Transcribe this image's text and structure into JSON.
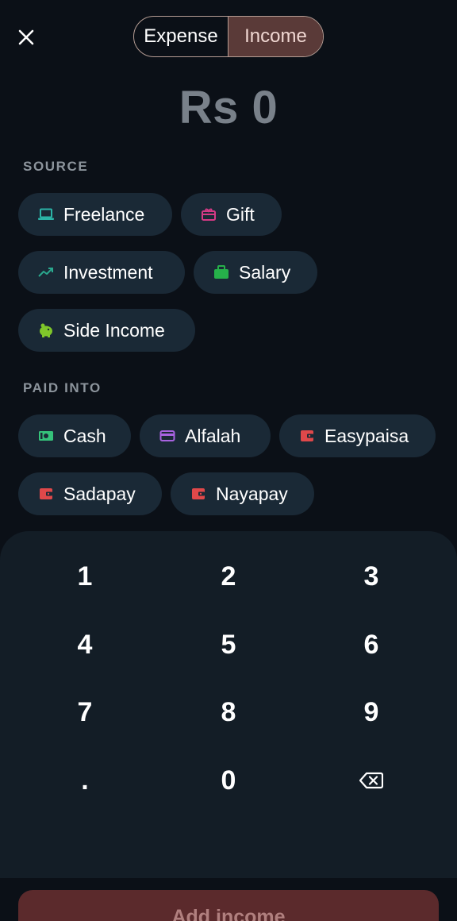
{
  "header": {
    "close_icon": "close-icon",
    "toggle": {
      "expense_label": "Expense",
      "income_label": "Income",
      "active": "income"
    }
  },
  "amount": {
    "display": "Rs 0"
  },
  "source": {
    "label": "SOURCE",
    "items": [
      {
        "label": "Freelance",
        "icon": "laptop-icon",
        "color": "#2bb3a6"
      },
      {
        "label": "Gift",
        "icon": "gift-icon",
        "color": "#d63a86"
      },
      {
        "label": "Investment",
        "icon": "trending-up-icon",
        "color": "#2aa88e"
      },
      {
        "label": "Salary",
        "icon": "briefcase-icon",
        "color": "#26b14a"
      },
      {
        "label": "Side Income",
        "icon": "piggy-bank-icon",
        "color": "#7fc62a"
      }
    ]
  },
  "paid_into": {
    "label": "PAID INTO",
    "items": [
      {
        "label": "Cash",
        "icon": "cash-icon",
        "color": "#35c27a"
      },
      {
        "label": "Alfalah",
        "icon": "credit-card-icon",
        "color": "#a863e0"
      },
      {
        "label": "Easypaisa",
        "icon": "wallet-icon",
        "color": "#e0484a"
      },
      {
        "label": "Sadapay",
        "icon": "wallet-icon",
        "color": "#e0484a"
      },
      {
        "label": "Nayapay",
        "icon": "wallet-icon",
        "color": "#e0484a"
      }
    ]
  },
  "keypad": {
    "keys": [
      "1",
      "2",
      "3",
      "4",
      "5",
      "6",
      "7",
      "8",
      "9",
      ".",
      "0"
    ],
    "backspace_icon": "backspace-icon"
  },
  "footer": {
    "add_button_label": "Add income"
  }
}
